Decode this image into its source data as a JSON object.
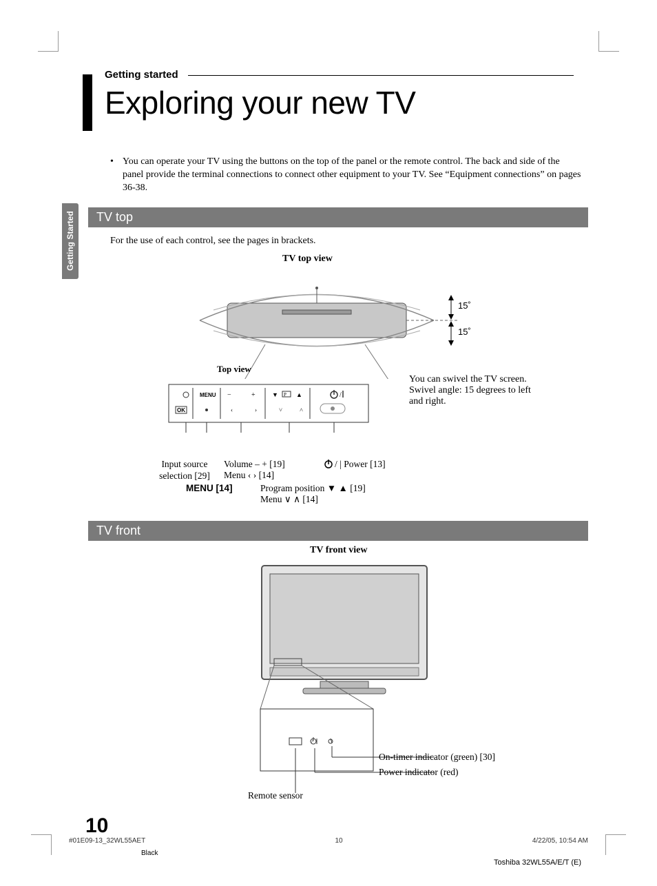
{
  "header": {
    "section_label": "Getting started",
    "title": "Exploring your new TV"
  },
  "side_tab": "Getting Started",
  "intro_bullet": "You can operate your TV using the buttons on the top of the panel or the remote control. The back and side of the panel provide the terminal connections to connect other equipment to your TV. See “Equipment connections” on pages 36-38.",
  "tv_top": {
    "header": "TV top",
    "intro": "For the use of each control, see the pages in brackets.",
    "diagram_title": "TV top view",
    "top_view_label": "Top view",
    "swivel_text": "You can swivel the TV screen.\nSwivel angle: 15 degrees to left and right.",
    "angle_1": "15˚",
    "angle_2": "15˚",
    "panel_labels": {
      "menu": "MENU",
      "ok": "OK"
    },
    "callouts": {
      "input_source": "Input source selection [29]",
      "volume": "Volume – + [19]",
      "menu_lr": "Menu  ‹  › [14]",
      "menu_ref": "MENU [14]",
      "program_pos": "Program position ▼ ▲ [19]",
      "menu_ud": "Menu  ∨ ∧ [14]",
      "power": "| Power [13]"
    }
  },
  "tv_front": {
    "header": "TV front",
    "diagram_title": "TV front view",
    "callouts": {
      "on_timer": "On-timer indicator (green) [30]",
      "power_ind": "Power indicator (red)",
      "remote_sensor": "Remote sensor"
    }
  },
  "page_number": "10",
  "footer": {
    "left": "#01E09-13_32WL55AET",
    "center": "10",
    "right": "4/22/05, 10:54 AM",
    "black": "Black",
    "model": "Toshiba 32WL55A/E/T (E)"
  }
}
